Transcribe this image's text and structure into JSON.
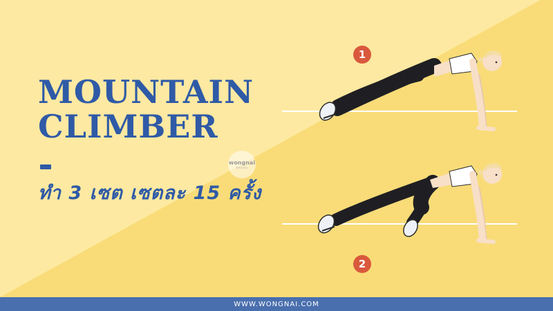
{
  "title": {
    "line1": "MOUNTAIN",
    "line2": "CLIMBER"
  },
  "subtitle": "ทำ 3 เซต เซตละ 15 ครั้ง",
  "steps": [
    {
      "number": "1"
    },
    {
      "number": "2"
    }
  ],
  "watermark": {
    "logo": "wongnai",
    "tagline": "beauty"
  },
  "footer": {
    "url": "WWW.WONGNAI.COM"
  },
  "colors": {
    "background_light": "#fde9a1",
    "background_dark": "#f9dc78",
    "title": "#2f5aa6",
    "badge": "#d9593d",
    "footer": "#4a6fae",
    "leggings": "#1f1f23",
    "top": "#ffffff",
    "skin": "#f8dfc8",
    "hair": "#f4dda5"
  }
}
